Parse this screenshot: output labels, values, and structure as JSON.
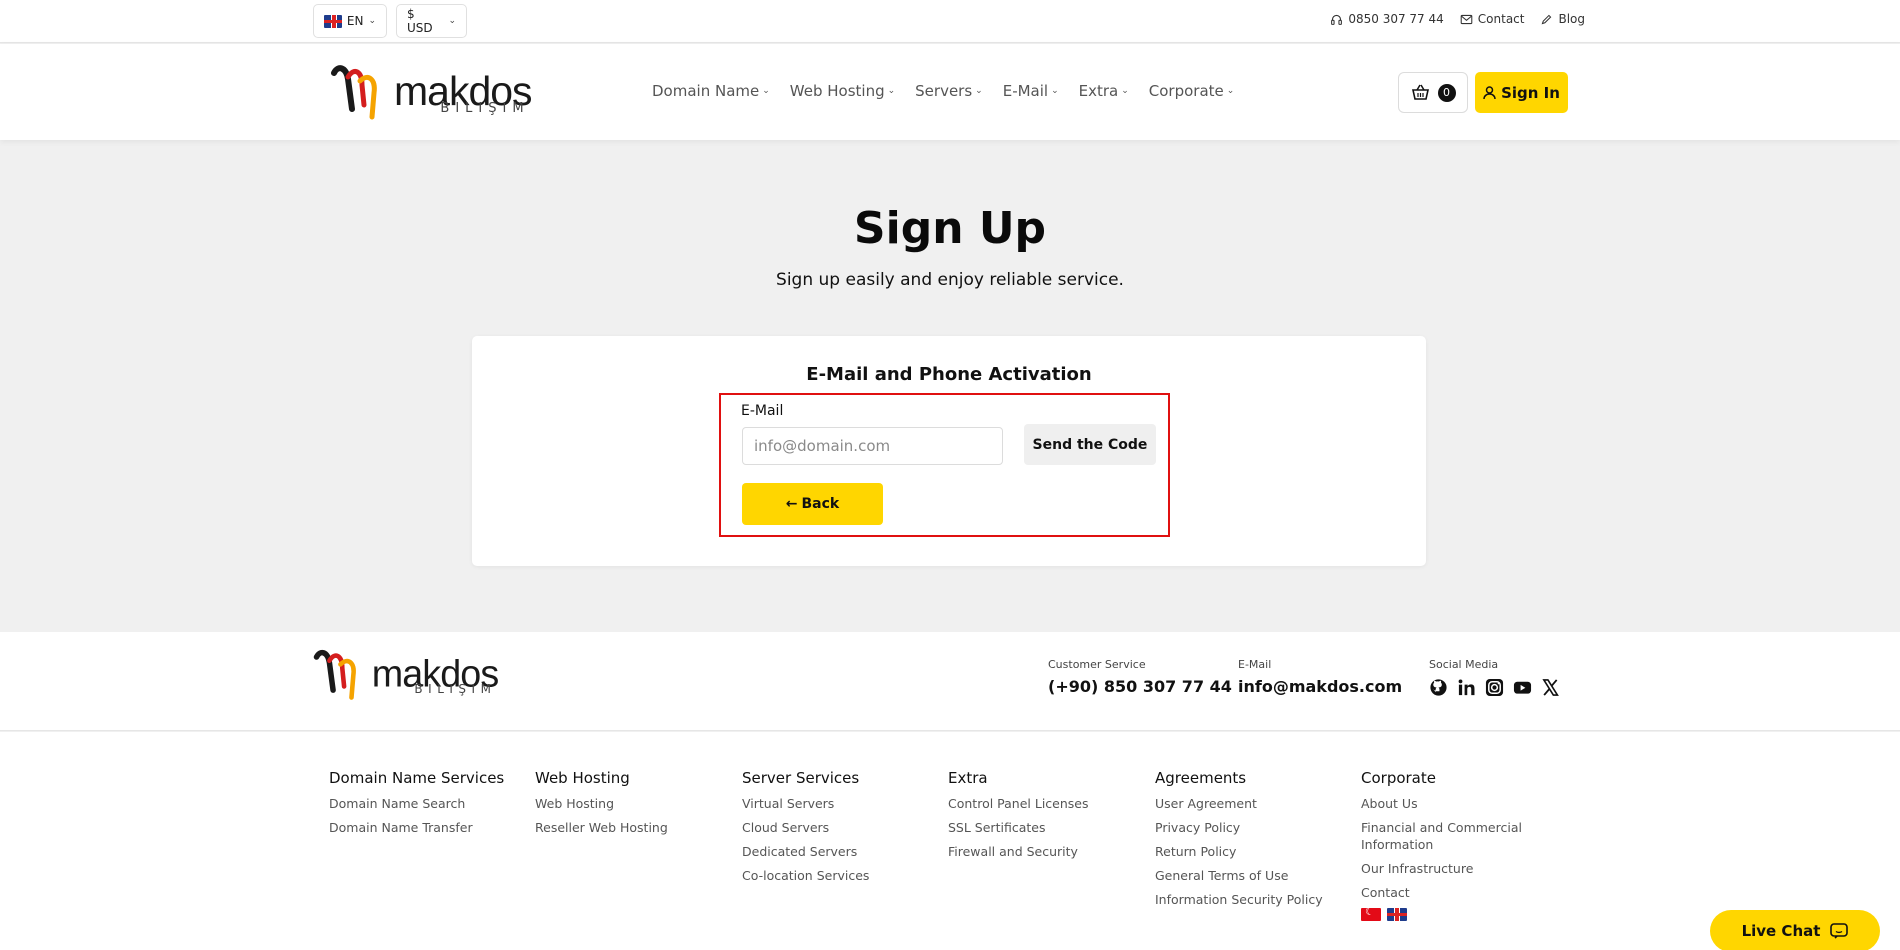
{
  "topbar": {
    "language": "EN",
    "currency": "$ USD",
    "phone": "0850 307 77 44",
    "contact": "Contact",
    "blog": "Blog"
  },
  "brand": {
    "name": "makdos",
    "sub": "BILIŞIM"
  },
  "nav": {
    "items": [
      "Domain Name",
      "Web Hosting",
      "Servers",
      "E-Mail",
      "Extra",
      "Corporate"
    ]
  },
  "cart": {
    "count": "0"
  },
  "signin_label": "Sign In",
  "hero": {
    "title": "Sign Up",
    "subtitle": "Sign up easily and enjoy reliable service."
  },
  "form": {
    "heading": "E-Mail and Phone Activation",
    "email_label": "E-Mail",
    "email_placeholder": "info@domain.com",
    "email_value": "",
    "send_label": "Send the Code",
    "back_label": "Back"
  },
  "footer_contact": {
    "customer_service_caption": "Customer Service",
    "customer_service_value": "(+90) 850 307 77 44",
    "email_caption": "E-Mail",
    "email_value": "info@makdos.com",
    "social_caption": "Social Media",
    "socials": [
      "github-icon",
      "linkedin-icon",
      "instagram-icon",
      "youtube-icon",
      "x-icon"
    ]
  },
  "footer_columns": [
    {
      "title": "Domain Name Services",
      "links": [
        "Domain Name Search",
        "Domain Name Transfer"
      ]
    },
    {
      "title": "Web Hosting",
      "links": [
        "Web Hosting",
        "Reseller Web Hosting"
      ]
    },
    {
      "title": "Server Services",
      "links": [
        "Virtual Servers",
        "Cloud Servers",
        "Dedicated Servers",
        "Co-location Services"
      ]
    },
    {
      "title": "Extra",
      "links": [
        "Control Panel Licenses",
        "SSL Sertificates",
        "Firewall and Security"
      ]
    },
    {
      "title": "Agreements",
      "links": [
        "User Agreement",
        "Privacy Policy",
        "Return Policy",
        "General Terms of Use",
        "Information Security Policy"
      ]
    },
    {
      "title": "Corporate",
      "links": [
        "About Us",
        "Financial and Commercial Information",
        "Our Infrastructure",
        "Contact"
      ]
    }
  ],
  "live_chat_label": "Live Chat",
  "colors": {
    "accent": "#ffd600",
    "highlight": "#e01010"
  }
}
